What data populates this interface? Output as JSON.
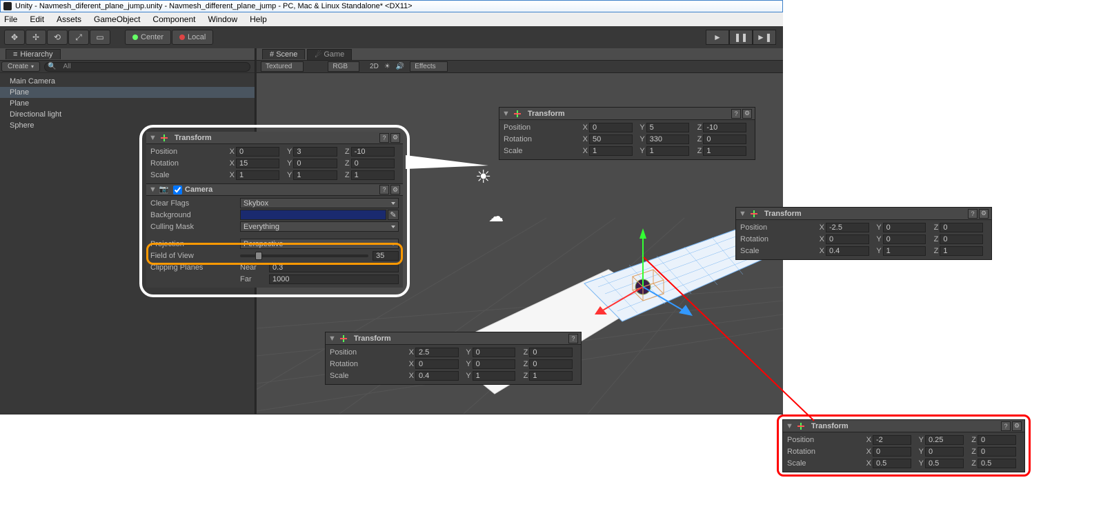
{
  "title": "Unity - Navmesh_diferent_plane_jump.unity - Navmesh_different_plane_jump - PC, Mac & Linux Standalone* <DX11>",
  "menu": {
    "file": "File",
    "edit": "Edit",
    "assets": "Assets",
    "gameobject": "GameObject",
    "component": "Component",
    "window": "Window",
    "help": "Help"
  },
  "pivot": {
    "center": "Center",
    "local": "Local"
  },
  "hierarchy": {
    "tab": "Hierarchy",
    "create": "Create",
    "search_placeholder": "All",
    "items": [
      "Main Camera",
      "Plane",
      "Plane",
      "Directional light",
      "Sphere"
    ]
  },
  "scene_tabs": {
    "scene": "Scene",
    "game": "Game"
  },
  "scene_toolbar": {
    "shading": "Textured",
    "render": "RGB",
    "mode2d": "2D",
    "effects": "Effects"
  },
  "insp_camera": {
    "transform_title": "Transform",
    "position_lbl": "Position",
    "pos": {
      "x": "0",
      "y": "5",
      "z": "-10"
    },
    "rotation_lbl": "Rotation",
    "rot": {
      "x": "50",
      "y": "330",
      "z": "0"
    },
    "scale_lbl": "Scale",
    "scl": {
      "x": "1",
      "y": "1",
      "z": "1"
    }
  },
  "insp_plane2": {
    "transform_title": "Transform",
    "position_lbl": "Position",
    "pos": {
      "x": "-2.5",
      "y": "0",
      "z": "0"
    },
    "rotation_lbl": "Rotation",
    "rot": {
      "x": "0",
      "y": "0",
      "z": "0"
    },
    "scale_lbl": "Scale",
    "scl": {
      "x": "0.4",
      "y": "1",
      "z": "1"
    }
  },
  "insp_plane1": {
    "transform_title": "Transform",
    "position_lbl": "Position",
    "pos": {
      "x": "2.5",
      "y": "0",
      "z": "0"
    },
    "rotation_lbl": "Rotation",
    "rot": {
      "x": "0",
      "y": "0",
      "z": "0"
    },
    "scale_lbl": "Scale",
    "scl": {
      "x": "0.4",
      "y": "1",
      "z": "1"
    }
  },
  "insp_sphere": {
    "transform_title": "Transform",
    "position_lbl": "Position",
    "pos": {
      "x": "-2",
      "y": "0.25",
      "z": "0"
    },
    "rotation_lbl": "Rotation",
    "rot": {
      "x": "0",
      "y": "0",
      "z": "0"
    },
    "scale_lbl": "Scale",
    "scl": {
      "x": "0.5",
      "y": "0.5",
      "z": "0.5"
    }
  },
  "bubble": {
    "transform_title": "Transform",
    "position_lbl": "Position",
    "pos": {
      "x": "0",
      "y": "3",
      "z": "-10"
    },
    "rotation_lbl": "Rotation",
    "rot": {
      "x": "15",
      "y": "0",
      "z": "0"
    },
    "scale_lbl": "Scale",
    "scl": {
      "x": "1",
      "y": "1",
      "z": "1"
    },
    "camera_title": "Camera",
    "clear_flags_lbl": "Clear Flags",
    "clear_flags": "Skybox",
    "background_lbl": "Background",
    "culling_lbl": "Culling Mask",
    "culling": "Everything",
    "projection_lbl": "Projection",
    "projection": "Perspective",
    "fov_lbl": "Field of View",
    "fov": "35",
    "clipping_lbl": "Clipping Planes",
    "near_lbl": "Near",
    "near": "0.3",
    "far_lbl": "Far",
    "far": "1000"
  },
  "axis": {
    "x": "X",
    "y": "Y",
    "z": "Z"
  }
}
